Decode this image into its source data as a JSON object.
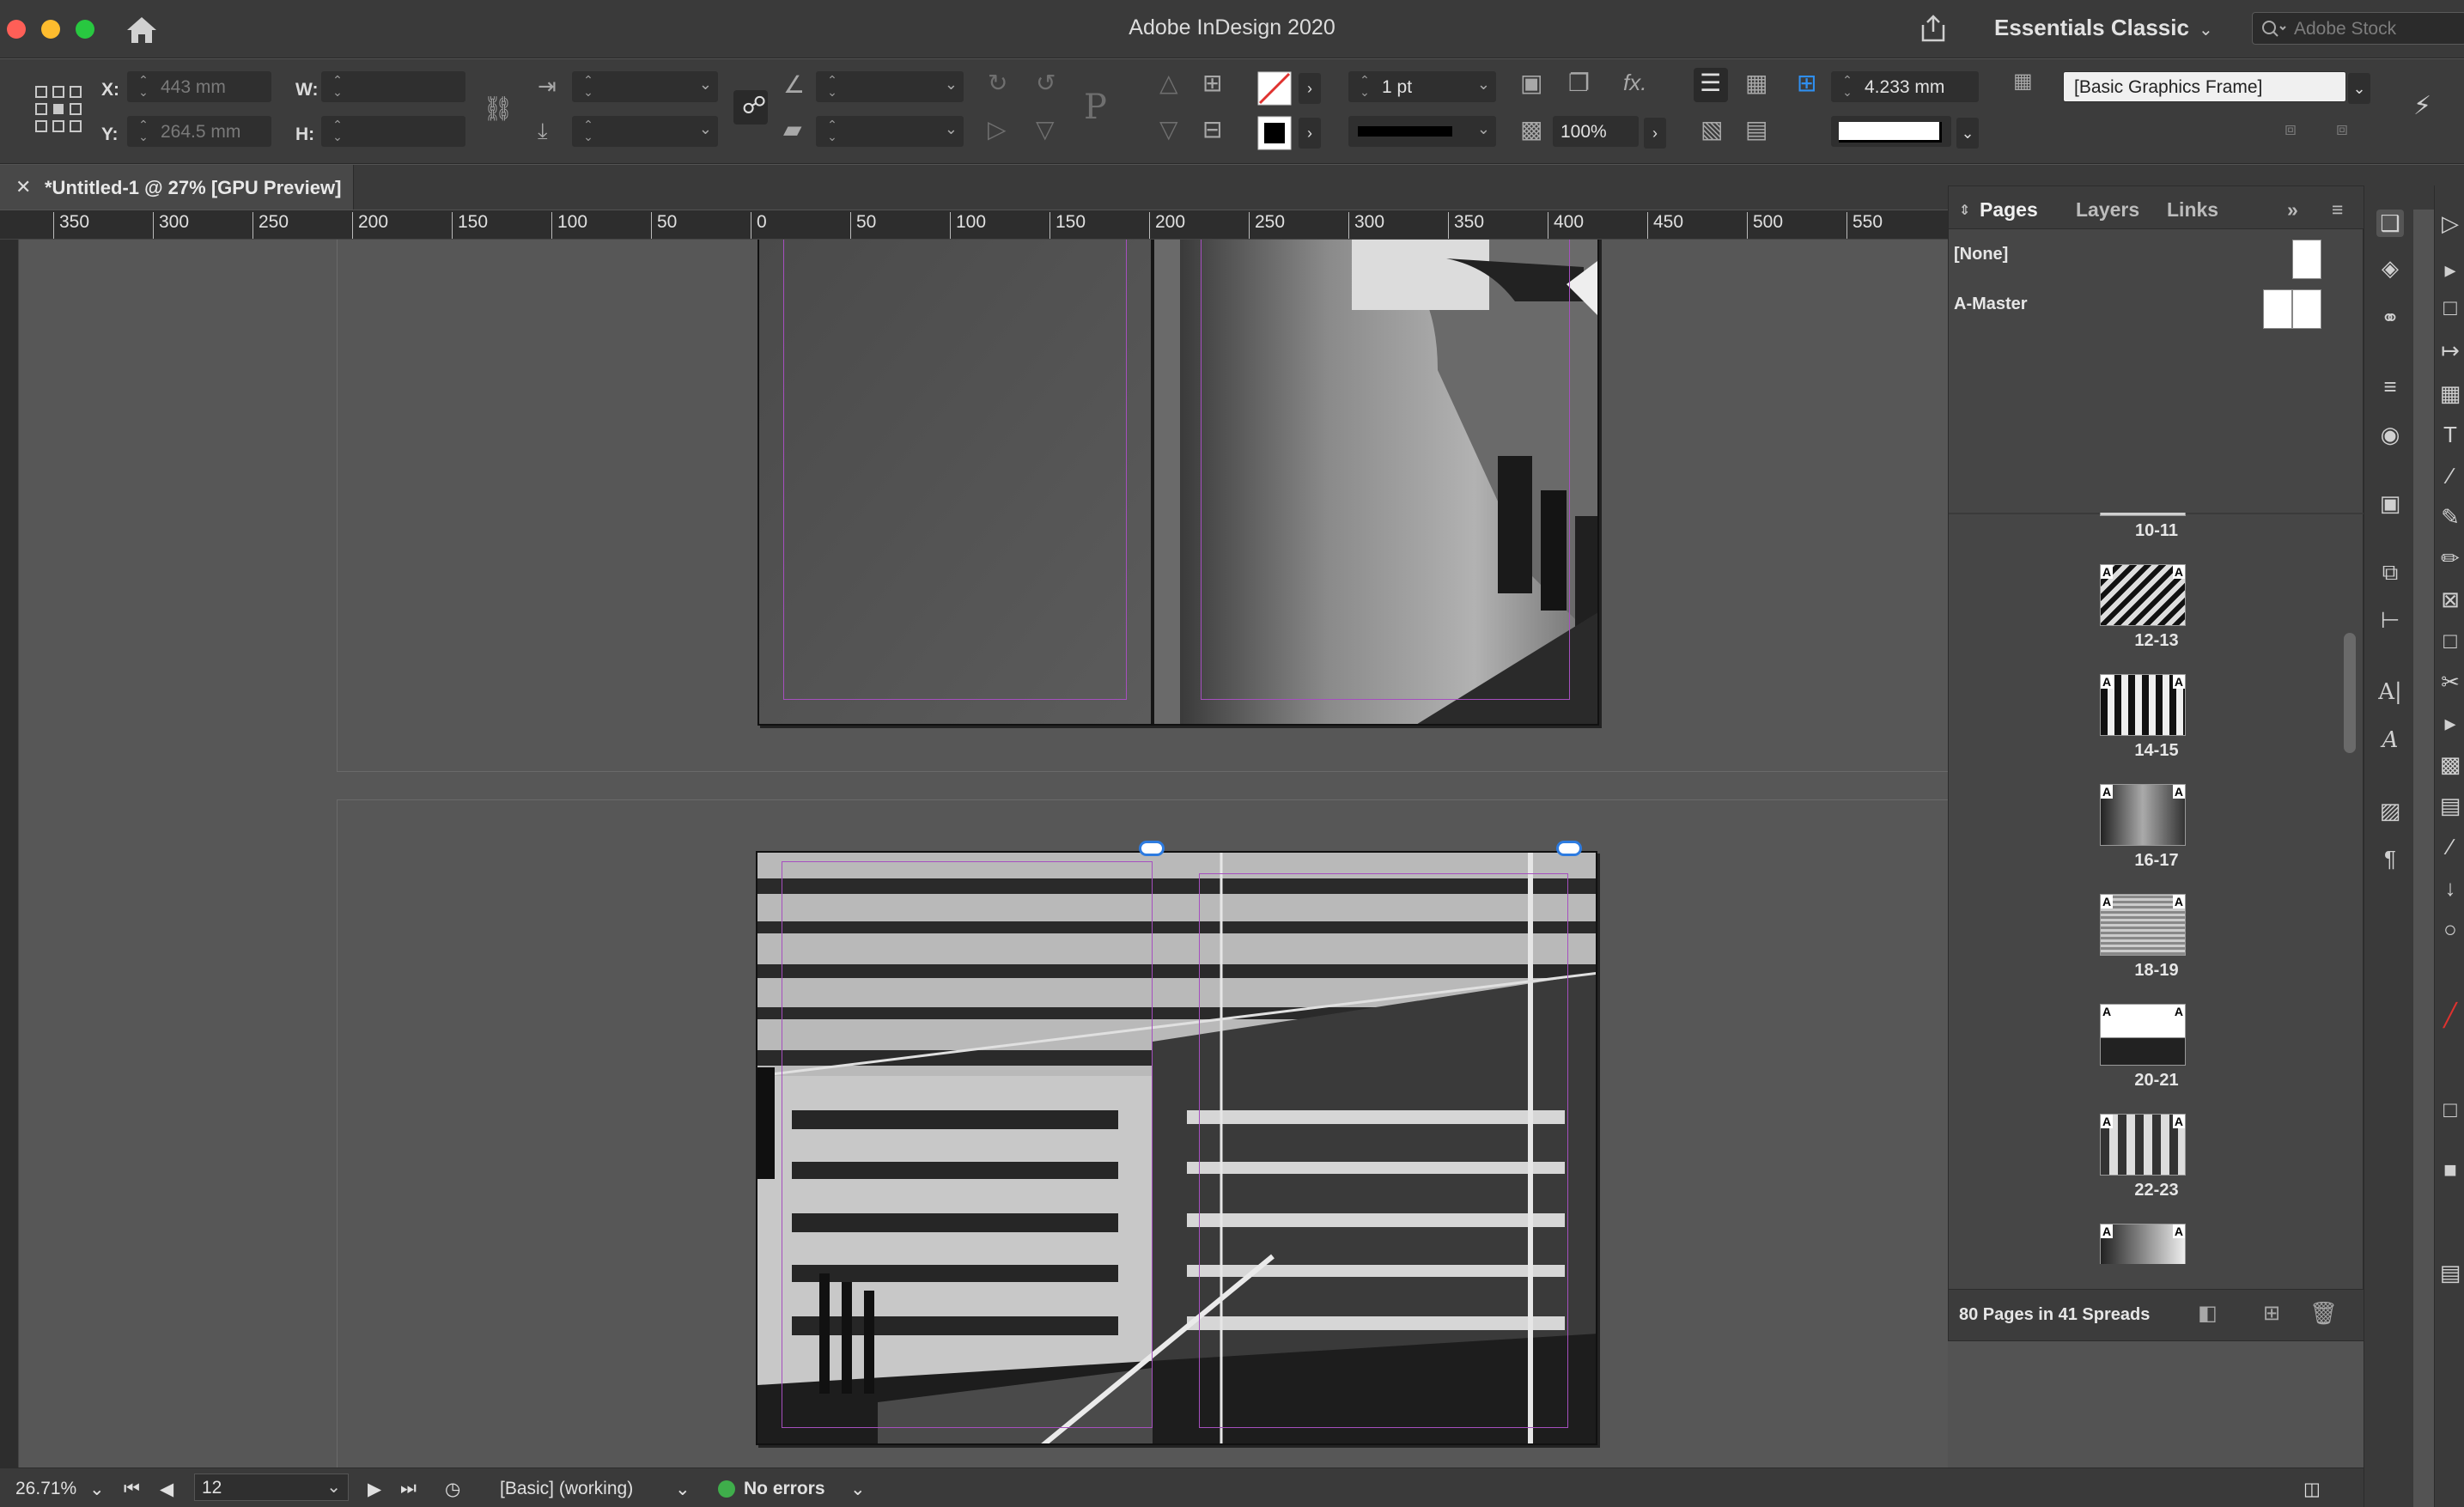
{
  "titlebar": {
    "app_title": "Adobe InDesign 2020",
    "workspace": "Essentials Classic",
    "search_placeholder": "Adobe Stock"
  },
  "control": {
    "x_label": "X:",
    "x_value": "443 mm",
    "y_label": "Y:",
    "y_value": "264.5 mm",
    "w_label": "W:",
    "h_label": "H:",
    "stroke_weight": "1 pt",
    "opacity": "100%",
    "offset": "4.233 mm",
    "object_style": "[Basic Graphics Frame]"
  },
  "document": {
    "tab_title": "*Untitled-1 @ 27% [GPU Preview]"
  },
  "ruler": {
    "labels": [
      "350",
      "300",
      "250",
      "200",
      "150",
      "100",
      "50",
      "0",
      "50",
      "100",
      "150",
      "200",
      "250",
      "300",
      "350",
      "400",
      "450",
      "500",
      "550"
    ]
  },
  "pages_panel": {
    "tabs": [
      "Pages",
      "Layers",
      "Links"
    ],
    "masters": [
      "[None]",
      "A-Master"
    ],
    "spreads": [
      "10-11",
      "12-13",
      "14-15",
      "16-17",
      "18-19",
      "20-21",
      "22-23"
    ],
    "summary": "80 Pages in 41 Spreads"
  },
  "status": {
    "zoom": "26.71%",
    "page": "12",
    "preflight_profile": "[Basic] (working)",
    "errors": "No errors"
  },
  "colors": {
    "guide": "#a64fbf",
    "link_badge": "#2d7be0",
    "status_ok": "#3fae4b"
  }
}
